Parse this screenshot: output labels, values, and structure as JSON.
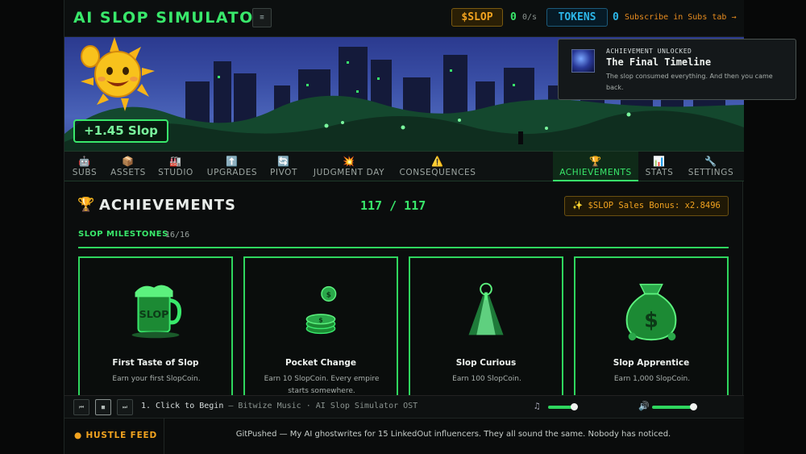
{
  "header": {
    "title": "AI SLOP SIMULATOR",
    "menu_glyph": "≡",
    "slop_label": "$SLOP",
    "slop_value": "0",
    "slop_rate": "0/s",
    "tokens_label": "TOKENS",
    "tokens_value": "0",
    "tokens_hint": "Subscribe in Subs tab →"
  },
  "banner": {
    "gain_text": "+1.45 Slop"
  },
  "toast": {
    "kicker": "ACHIEVEMENT UNLOCKED",
    "title": "The Final Timeline",
    "body": "The slop consumed everything. And then you came back."
  },
  "tabs": [
    {
      "icon": "🤖",
      "label": "SUBS"
    },
    {
      "icon": "📦",
      "label": "ASSETS"
    },
    {
      "icon": "🏭",
      "label": "STUDIO"
    },
    {
      "icon": "⬆️",
      "label": "UPGRADES"
    },
    {
      "icon": "🔄",
      "label": "PIVOT"
    },
    {
      "icon": "💥",
      "label": "JUDGMENT DAY"
    },
    {
      "icon": "⚠️",
      "label": "CONSEQUENCES"
    },
    {
      "icon": "🏆",
      "label": "ACHIEVEMENTS"
    },
    {
      "icon": "📊",
      "label": "STATS"
    },
    {
      "icon": "🔧",
      "label": "SETTINGS"
    }
  ],
  "main": {
    "heading_icon": "🏆",
    "heading": "ACHIEVEMENTS",
    "count": "117 / 117",
    "bonus": "✨ $SLOP Sales Bonus: x2.8496",
    "section_title": "SLOP MILESTONES",
    "section_count": "16/16",
    "cards": [
      {
        "name": "First Taste of Slop",
        "desc": "Earn your first SlopCoin.",
        "icon": "slop-mug-icon"
      },
      {
        "name": "Pocket Change",
        "desc": "Earn 10 SlopCoin. Every empire starts somewhere.",
        "icon": "coin-stack-icon"
      },
      {
        "name": "Slop Curious",
        "desc": "Earn 100 SlopCoin.",
        "icon": "keyhole-light-icon"
      },
      {
        "name": "Slop Apprentice",
        "desc": "Earn 1,000 SlopCoin.",
        "icon": "money-bag-icon"
      }
    ]
  },
  "player": {
    "prev": "⏮",
    "play": "■",
    "next": "⏭",
    "track": "1. Click to Begin",
    "artist": "— Bitwize Music · AI Slop Simulator OST",
    "music_icon": "♫",
    "volume_icon": "🔊",
    "music_level": 0.35,
    "sfx_level": 0.55
  },
  "feed": {
    "label": "HUSTLE FEED",
    "bullet": "●",
    "text": "GitPushed — My AI ghostwrites for 15 LinkedOut influencers. They all sound the same. Nobody has noticed."
  },
  "colors": {
    "accent": "#39e86b",
    "gold": "#f2a31f",
    "tokens": "#2cb6e8",
    "bg": "#0b0d0d"
  }
}
